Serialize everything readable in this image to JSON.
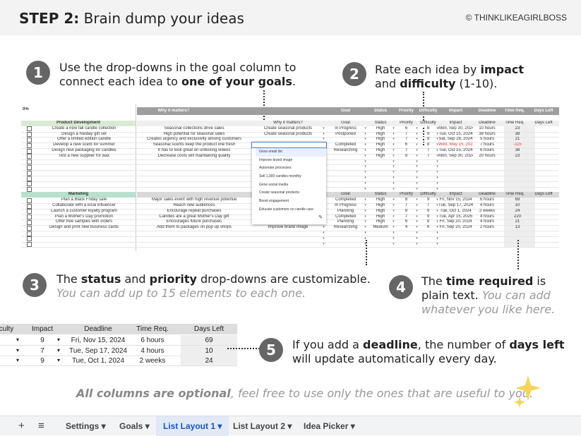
{
  "header": {
    "step": "STEP 2:",
    "title": "Brain dump your ideas",
    "copyright": "© THINKLIKEAGIRLBOSS"
  },
  "callouts": {
    "c1": {
      "num": "1",
      "line1": "Use the drop-downs in the goal column to",
      "line2a": "connect each idea to ",
      "line2b": "one of your goals",
      "line2c": "."
    },
    "c2": {
      "num": "2",
      "line1a": "Rate each idea by ",
      "line1b": "impact",
      "line2a": "and ",
      "line2b": "difficulty",
      "line2c": " (1-10)."
    },
    "c3": {
      "num": "3",
      "line1a": "The ",
      "line1b": "status",
      "line1c": " and ",
      "line1d": "priority",
      "line1e": " drop-downs are customizable.",
      "line2": "You can add up to 15 elements to each one."
    },
    "c4": {
      "num": "4",
      "line1a": "The ",
      "line1b": "time required",
      "line1c": " is",
      "line2a": "plain text. ",
      "line2b": "You can add",
      "line3": "whatever you like here."
    },
    "c5": {
      "num": "5",
      "line1a": "If you add a ",
      "line1b": "deadline",
      "line1c": ", the number of ",
      "line1d": "days left",
      "line2": "will update automatically every day."
    }
  },
  "footer_note": {
    "bold": "All columns are optional",
    "rest": ", feel free to use only the ones that are useful to you."
  },
  "sparkle_icon": "sparkles-icon",
  "sheet": {
    "progress": "0%",
    "headers": [
      "Why it matters?",
      "Goal",
      "Status",
      "Priority",
      "Difficulty",
      "Impact",
      "Deadline",
      "Time Req.",
      "Days Left"
    ],
    "sections": [
      {
        "name": "Product Development",
        "color": "#d9ead3",
        "rows": [
          [
            "Create a new fall candle collection",
            "Seasonal collections drive sales",
            "Create seasonal products",
            "In Progress",
            "High",
            "6",
            "8",
            "Mon, Sep 30, 2024",
            "10 hours",
            "23"
          ],
          [
            "Design a holiday gift set",
            "High potential for seasonal sales",
            "Create seasonal products",
            "Postponed",
            "High",
            "7",
            "9",
            "Tue, Oct 15, 2024",
            "38 hours",
            "38"
          ],
          [
            "Offer a limited edition candle",
            "Creates urgency and exclusivity among customers",
            "",
            "",
            "High",
            "7",
            "9",
            "Sat, Sep 28, 2024",
            "5 hours",
            "21"
          ],
          [
            "Develop a new scent for summer",
            "Seasonal scents keep the product line fresh",
            "",
            "Completed",
            "High",
            "6",
            "8",
            "Wed, May 15, 2024",
            "7 hours",
            "-115"
          ],
          [
            "Design new packaging for candles",
            "It has to look great on unboxing videos",
            "",
            "Researching",
            "High",
            "7",
            "7",
            "Tue, Oct 15, 2024",
            "6 hours",
            "38"
          ],
          [
            "Test a new supplier for wax",
            "Decrease costs will maintaining quality",
            "",
            "",
            "High",
            "8",
            "7",
            "Mon, Sep 30, 2024",
            "20 hours",
            "23"
          ]
        ]
      },
      {
        "name": "Marketing",
        "color": "#b7e1cd",
        "rows": [
          [
            "Plan a Black Friday sale",
            "Major sales event with high revenue potential",
            "",
            "Completed",
            "High",
            "8",
            "9",
            "Fri, Nov 15, 2024",
            "6 hours",
            "69"
          ],
          [
            "Collaborate with a local influencer",
            "Reach new audiences",
            "",
            "In Progress",
            "High",
            "7",
            "7",
            "Tue, Sep 17, 2024",
            "4 hours",
            "10"
          ],
          [
            "Launch a customer loyalty program",
            "Encourage repeat purchases",
            "",
            "Planning",
            "High",
            "8",
            "9",
            "Tue, Oct 1, 2024",
            "2 weeks",
            "24"
          ],
          [
            "Plan a Mother's Day promotion",
            "Candles are a great Mother's Day gift",
            "",
            "Completed",
            "High",
            "7",
            "9",
            "Tue, Apr 15, 2025",
            "4 hours",
            "220"
          ],
          [
            "Offer free samples with orders",
            "Encourages future purchases",
            "Sell 1,000 candles monthly",
            "Planning",
            "High",
            "6",
            "8",
            "Fri, Sep 20, 2024",
            "4 hours",
            "21"
          ],
          [
            "Design and print new business cards",
            "Add them to packages on pop up shops",
            "Improve brand image",
            "Researching",
            "Medium",
            "4",
            "6",
            "Fri, Sep 20, 2024",
            "2 hours",
            "13"
          ]
        ]
      }
    ],
    "dropdown": [
      "Grow email list",
      "Improve brand image",
      "Automate processes",
      "Sell 1,000 candles monthly",
      "Grow social media",
      "Create seasonal products",
      "Boost engagement",
      "Educate customers on candle care"
    ]
  },
  "zoom": {
    "headers": [
      "culty",
      "Impact",
      "Deadline",
      "Time Req.",
      "Days Left"
    ],
    "rows": [
      [
        "9",
        "Fri, Nov 15, 2024",
        "6 hours",
        "69"
      ],
      [
        "7",
        "Tue, Sep 17, 2024",
        "4 hours",
        "10"
      ],
      [
        "9",
        "Tue, Oct 1, 2024",
        "2 weeks",
        "24"
      ]
    ]
  },
  "tabs": {
    "add": "+",
    "menu": "≡",
    "items": [
      "Settings",
      "Goals",
      "List Layout 1",
      "List Layout 2",
      "Idea Picker"
    ]
  }
}
